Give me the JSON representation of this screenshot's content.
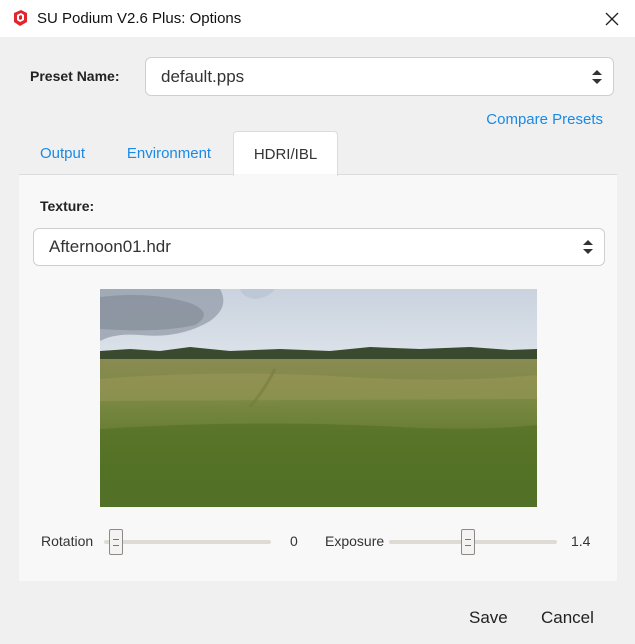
{
  "window": {
    "title": "SU Podium V2.6 Plus: Options",
    "app_icon": "sketchup-logo",
    "close_icon": "close-icon"
  },
  "preset": {
    "label": "Preset Name:",
    "value": "default.pps",
    "compare_link": "Compare Presets"
  },
  "tabs": [
    {
      "label": "Output",
      "active": false
    },
    {
      "label": "Environment",
      "active": false
    },
    {
      "label": "HDRI/IBL",
      "active": true
    }
  ],
  "hdri": {
    "texture_label": "Texture:",
    "texture_value": "Afternoon01.hdr",
    "preview_description_icon": "landscape-preview",
    "rotation": {
      "label": "Rotation",
      "value": "0",
      "fraction": 0.0
    },
    "exposure": {
      "label": "Exposure",
      "value": "1.4",
      "fraction": 0.47
    }
  },
  "footer": {
    "save_label": "Save",
    "cancel_label": "Cancel"
  },
  "colors": {
    "accent": "#1a8ae6",
    "background": "#f0f0f0",
    "panel": "#f8f8f8"
  }
}
